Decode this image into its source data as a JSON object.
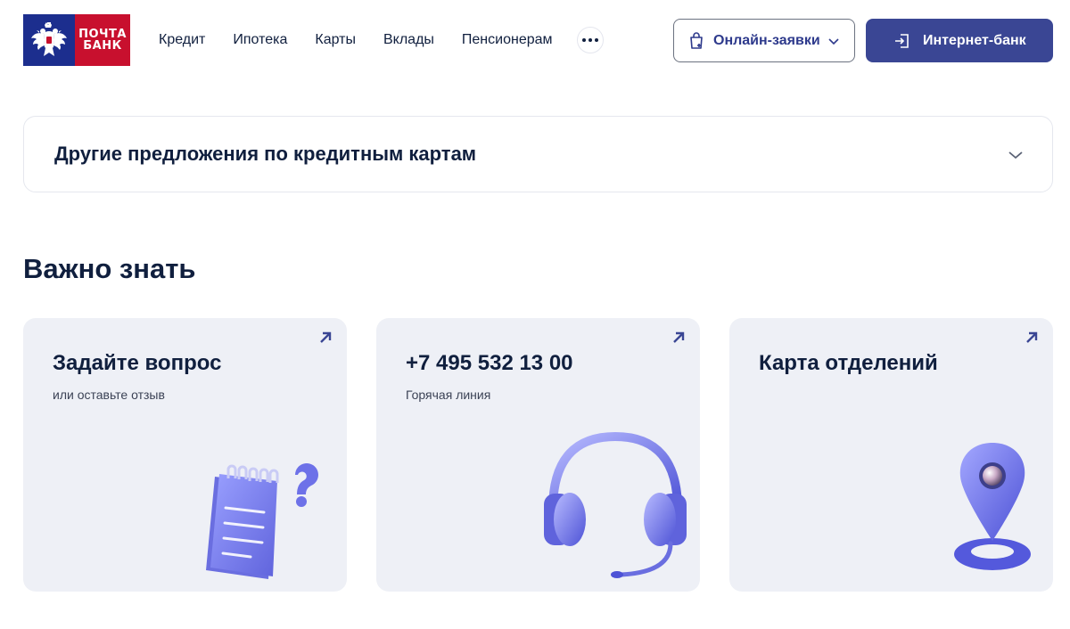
{
  "header": {
    "logo": {
      "line1": "ПОЧТА",
      "line2": "БАНК",
      "emblem_icon": "double-headed-eagle-emblem"
    },
    "nav": [
      "Кредит",
      "Ипотека",
      "Карты",
      "Вклады",
      "Пенсионерам"
    ],
    "more_icon": "ellipsis-icon",
    "online_button": {
      "label": "Онлайн-заявки",
      "icon": "shopping-bag-icon"
    },
    "internet_bank_button": {
      "label": "Интернет-банк",
      "icon": "login-icon"
    }
  },
  "accordion": {
    "title": "Другие предложения по кредитным картам"
  },
  "section": {
    "title": "Важно знать",
    "cards": [
      {
        "title": "Задайте вопрос",
        "subtitle": "или оставьте отзыв",
        "illustration": "notepad-question-icon"
      },
      {
        "title": "+7 495 532 13 00",
        "subtitle": "Горячая линия",
        "illustration": "headset-icon"
      },
      {
        "title": "Карта отделений",
        "subtitle": "",
        "illustration": "map-pin-icon"
      }
    ]
  },
  "colors": {
    "brand_blue": "#1c2e8e",
    "brand_red": "#c8102e",
    "primary_button": "#3a4694",
    "card_bg": "#eef0f6",
    "text_dark": "#101f3e",
    "illustration_purple": "#7c7ff0"
  }
}
